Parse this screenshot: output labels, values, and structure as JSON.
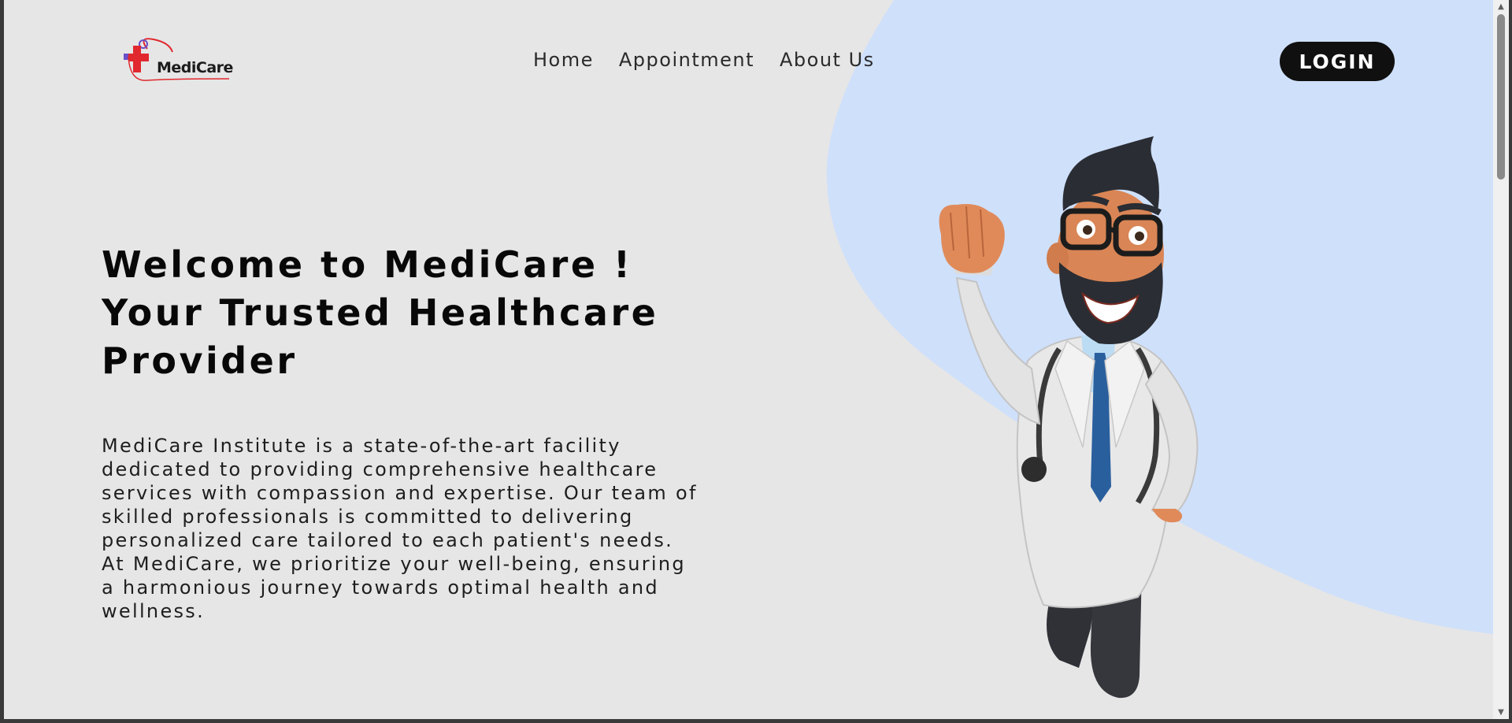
{
  "header": {
    "logo_text": "MediCare",
    "nav": [
      {
        "label": "Home"
      },
      {
        "label": "Appointment"
      },
      {
        "label": "About Us"
      }
    ],
    "login_label": "LOGIN"
  },
  "hero": {
    "title_lines": [
      "Welcome to MediCare !",
      "Your Trusted Healthcare",
      "Provider"
    ],
    "description_lines": [
      "MediCare Institute is a state-of-the-art facility",
      "dedicated to providing comprehensive healthcare",
      "services with compassion and expertise. Our team of",
      "skilled professionals is committed to delivering",
      "personalized care tailored to each patient's needs.",
      "At MediCare, we prioritize your well-being, ensuring",
      "a harmonious journey towards optimal health and",
      "wellness."
    ]
  },
  "colors": {
    "page_bg": "#e6e6e6",
    "blob": "#cfe0fb",
    "login_bg": "#101010",
    "logo_red": "#e0282e",
    "logo_purple": "#6a4fc7"
  },
  "icons": {
    "logo": "medical-cross-logo",
    "scroll_up": "triangle-up-icon",
    "scroll_down": "triangle-down-icon"
  }
}
